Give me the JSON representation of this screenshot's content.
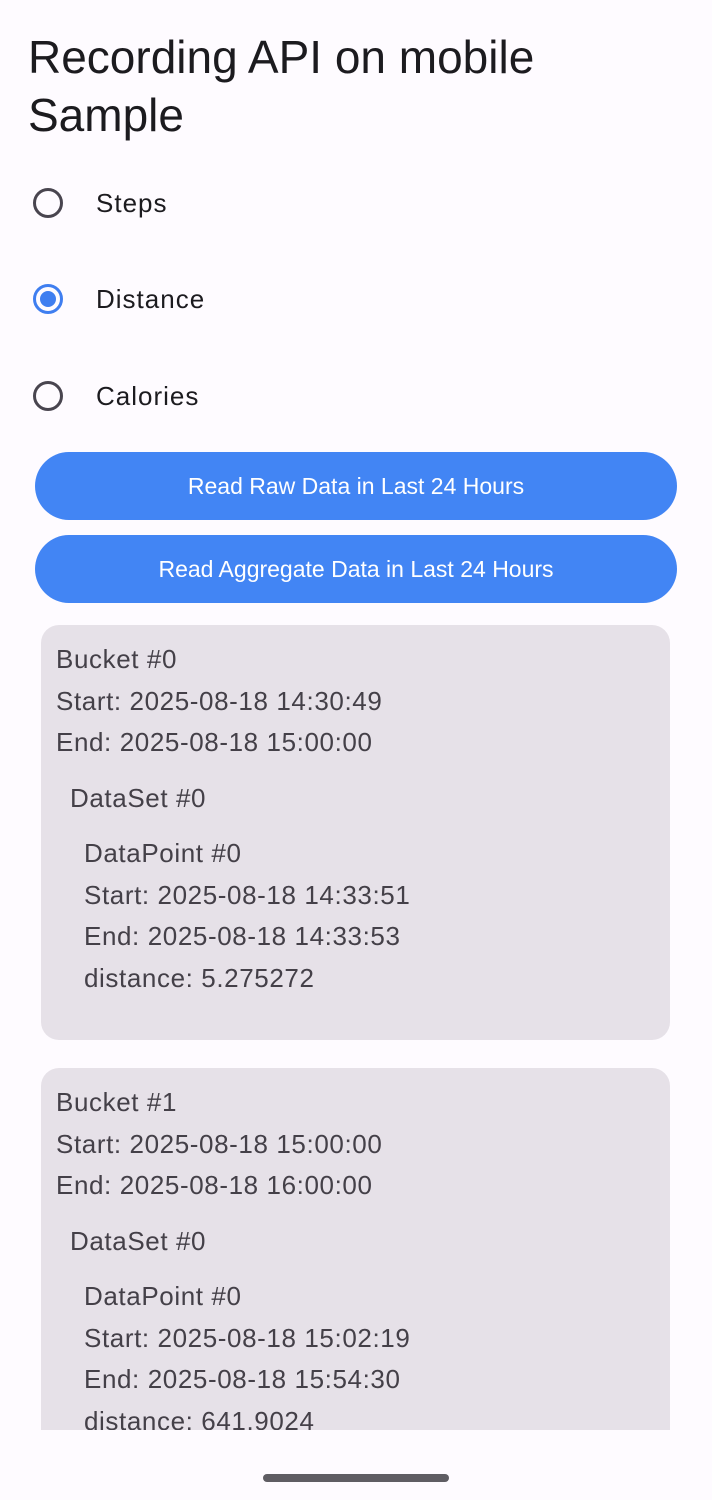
{
  "app": {
    "title": "Recording API on mobile Sample"
  },
  "data_types": {
    "options": [
      {
        "label": "Steps",
        "selected": false
      },
      {
        "label": "Distance",
        "selected": true
      },
      {
        "label": "Calories",
        "selected": false
      }
    ]
  },
  "actions": {
    "read_raw_label": "Read Raw Data in Last 24 Hours",
    "read_aggregate_label": "Read Aggregate Data in Last 24 Hours"
  },
  "colors": {
    "accent": "#4285f4",
    "radio_selected": "#3f7ef0",
    "card_background": "#e6e1e8",
    "page_background": "#fefbff"
  },
  "buckets": [
    {
      "title": "Bucket #0",
      "start": "Start: 2025-08-18 14:30:49",
      "end": "End: 2025-08-18 15:00:00",
      "dataset": {
        "title": "DataSet #0",
        "datapoint": {
          "title": "DataPoint #0",
          "start": "Start: 2025-08-18 14:33:51",
          "end": "End: 2025-08-18 14:33:53",
          "value": "distance: 5.275272"
        }
      }
    },
    {
      "title": "Bucket #1",
      "start": "Start: 2025-08-18 15:00:00",
      "end": "End: 2025-08-18 16:00:00",
      "dataset": {
        "title": "DataSet #0",
        "datapoint": {
          "title": "DataPoint #0",
          "start": "Start: 2025-08-18 15:02:19",
          "end": "End: 2025-08-18 15:54:30",
          "value": "distance: 641.9024"
        }
      }
    }
  ]
}
